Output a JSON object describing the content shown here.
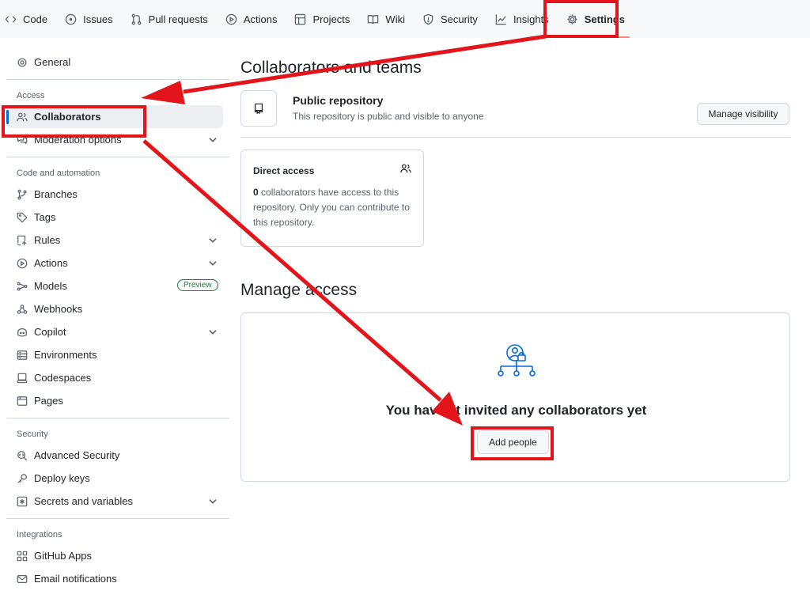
{
  "topnav": {
    "tabs": [
      {
        "label": "Code",
        "icon": "code-icon"
      },
      {
        "label": "Issues",
        "icon": "issue-opened-icon"
      },
      {
        "label": "Pull requests",
        "icon": "git-pull-request-icon"
      },
      {
        "label": "Actions",
        "icon": "play-icon"
      },
      {
        "label": "Projects",
        "icon": "table-icon"
      },
      {
        "label": "Wiki",
        "icon": "book-icon"
      },
      {
        "label": "Security",
        "icon": "shield-icon"
      },
      {
        "label": "Insights",
        "icon": "graph-icon"
      },
      {
        "label": "Settings",
        "icon": "gear-icon",
        "active": true
      }
    ]
  },
  "sidebar": {
    "general": "General",
    "access_title": "Access",
    "collaborators": "Collaborators",
    "moderation": "Moderation options",
    "code_automation_title": "Code and automation",
    "branches": "Branches",
    "tags": "Tags",
    "rules": "Rules",
    "actions": "Actions",
    "models": "Models",
    "models_badge": "Preview",
    "webhooks": "Webhooks",
    "copilot": "Copilot",
    "environments": "Environments",
    "codespaces": "Codespaces",
    "pages": "Pages",
    "security_title": "Security",
    "advanced_security": "Advanced Security",
    "deploy_keys": "Deploy keys",
    "secrets": "Secrets and variables",
    "integrations_title": "Integrations",
    "github_apps": "GitHub Apps",
    "email_notifications": "Email notifications"
  },
  "main": {
    "title": "Collaborators and teams",
    "repo_visibility_title": "Public repository",
    "repo_visibility_desc": "This repository is public and visible to anyone",
    "manage_visibility_button": "Manage visibility",
    "direct_access_title": "Direct access",
    "direct_access_count": "0",
    "direct_access_text": " collaborators have access to this repository. Only you can contribute to this repository.",
    "manage_access_title": "Manage access",
    "empty_state_title": "You haven't invited any collaborators yet",
    "add_people_button": "Add people"
  },
  "colors": {
    "annotation_red": "#e3141a",
    "accent_blue": "#0969da",
    "preview_green": "#1a7f37"
  }
}
